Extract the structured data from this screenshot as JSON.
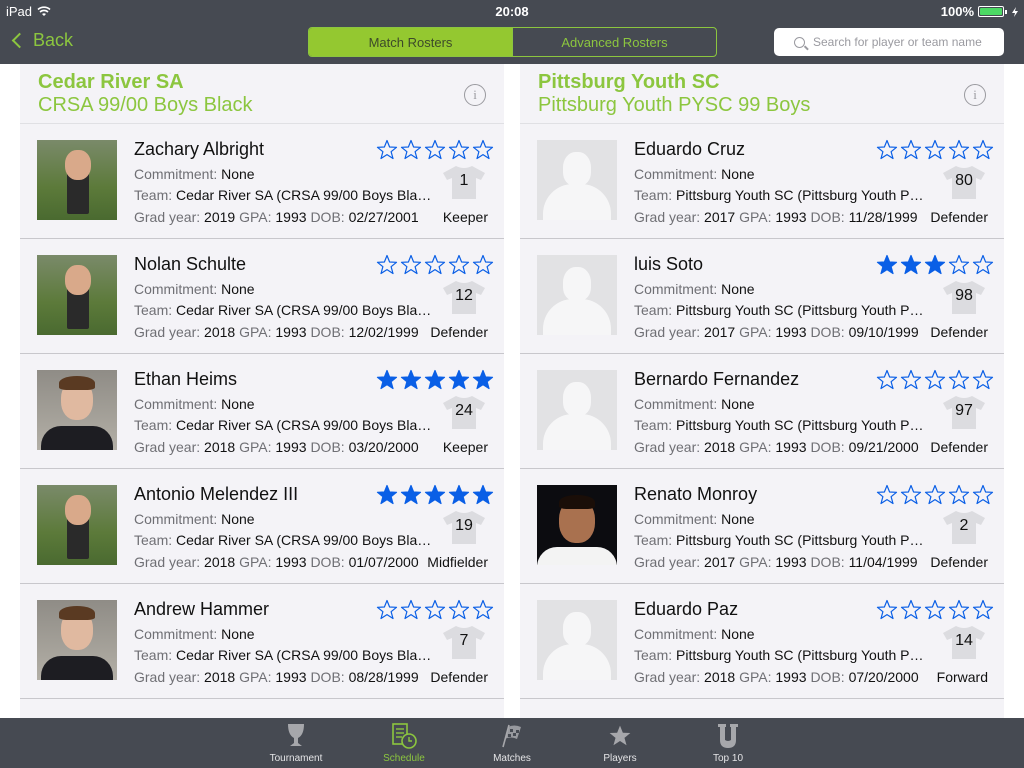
{
  "status_bar": {
    "device": "iPad",
    "time": "20:08",
    "battery": "100%",
    "battery_level": 1.0
  },
  "nav": {
    "back_label": "Back",
    "segments": [
      {
        "label": "Match Rosters",
        "active": true
      },
      {
        "label": "Advanced Rosters",
        "active": false
      }
    ],
    "search_placeholder": "Search for player or team name"
  },
  "colors": {
    "accent": "#8cc63f",
    "star_blue": "#0a5fe6",
    "bar_bg": "#464a52",
    "panel_bg": "#f4f3f7"
  },
  "labels": {
    "commitment": "Commitment:",
    "team": "Team:",
    "grad_year": "Grad year:",
    "gpa": "GPA:",
    "dob": "DOB:"
  },
  "rosters": [
    {
      "club": "Cedar River SA",
      "team": "CRSA 99/00 Boys Black",
      "players": [
        {
          "name": "Zachary Albright",
          "commitment": "None",
          "team": "Cedar River SA (CRSA 99/00 Boys Bla…",
          "grad_year": "2019",
          "gpa": "1993",
          "dob": "02/27/2001",
          "number": "1",
          "position": "Keeper",
          "rating": 0,
          "photo": "real"
        },
        {
          "name": "Nolan Schulte",
          "commitment": "None",
          "team": "Cedar River SA (CRSA 99/00 Boys Bla…",
          "grad_year": "2018",
          "gpa": "1993",
          "dob": "12/02/1999",
          "number": "12",
          "position": "Defender",
          "rating": 0,
          "photo": "real"
        },
        {
          "name": "Ethan Heims",
          "commitment": "None",
          "team": "Cedar River SA (CRSA 99/00 Boys Bla…",
          "grad_year": "2018",
          "gpa": "1993",
          "dob": "03/20/2000",
          "number": "24",
          "position": "Keeper",
          "rating": 5,
          "photo": "portrait"
        },
        {
          "name": "Antonio Melendez III",
          "commitment": "None",
          "team": "Cedar River SA (CRSA 99/00 Boys Bla…",
          "grad_year": "2018",
          "gpa": "1993",
          "dob": "01/07/2000",
          "number": "19",
          "position": "Midfielder",
          "rating": 5,
          "photo": "real"
        },
        {
          "name": "Andrew Hammer",
          "commitment": "None",
          "team": "Cedar River SA (CRSA 99/00 Boys Bla…",
          "grad_year": "2018",
          "gpa": "1993",
          "dob": "08/28/1999",
          "number": "7",
          "position": "Defender",
          "rating": 0,
          "photo": "portrait"
        }
      ]
    },
    {
      "club": "Pittsburg Youth SC",
      "team": "Pittsburg Youth PYSC 99 Boys",
      "players": [
        {
          "name": "Eduardo Cruz",
          "commitment": "None",
          "team": "Pittsburg Youth SC (Pittsburg Youth P…",
          "grad_year": "2017",
          "gpa": "1993",
          "dob": "11/28/1999",
          "number": "80",
          "position": "Defender",
          "rating": 0,
          "photo": "placeholder"
        },
        {
          "name": "luis Soto",
          "commitment": "None",
          "team": "Pittsburg Youth SC (Pittsburg Youth P…",
          "grad_year": "2017",
          "gpa": "1993",
          "dob": "09/10/1999",
          "number": "98",
          "position": "Defender",
          "rating": 3,
          "photo": "placeholder"
        },
        {
          "name": "Bernardo  Fernandez",
          "commitment": "None",
          "team": "Pittsburg Youth SC (Pittsburg Youth P…",
          "grad_year": "2018",
          "gpa": "1993",
          "dob": "09/21/2000",
          "number": "97",
          "position": "Defender",
          "rating": 0,
          "photo": "placeholder"
        },
        {
          "name": "Renato Monroy",
          "commitment": "None",
          "team": "Pittsburg Youth SC (Pittsburg Youth P…",
          "grad_year": "2017",
          "gpa": "1993",
          "dob": "11/04/1999",
          "number": "2",
          "position": "Defender",
          "rating": 0,
          "photo": "dark"
        },
        {
          "name": "Eduardo Paz",
          "commitment": "None",
          "team": "Pittsburg Youth SC (Pittsburg Youth P…",
          "grad_year": "2018",
          "gpa": "1993",
          "dob": "07/20/2000",
          "number": "14",
          "position": "Forward",
          "rating": 0,
          "photo": "placeholder"
        }
      ]
    }
  ],
  "tabbar": [
    {
      "label": "Tournament",
      "icon": "trophy-icon",
      "active": false
    },
    {
      "label": "Schedule",
      "icon": "schedule-icon",
      "active": true
    },
    {
      "label": "Matches",
      "icon": "checkered-flag-icon",
      "active": false
    },
    {
      "label": "Players",
      "icon": "star-icon",
      "active": false
    },
    {
      "label": "Top 10",
      "icon": "top10-u-icon",
      "active": false
    }
  ]
}
